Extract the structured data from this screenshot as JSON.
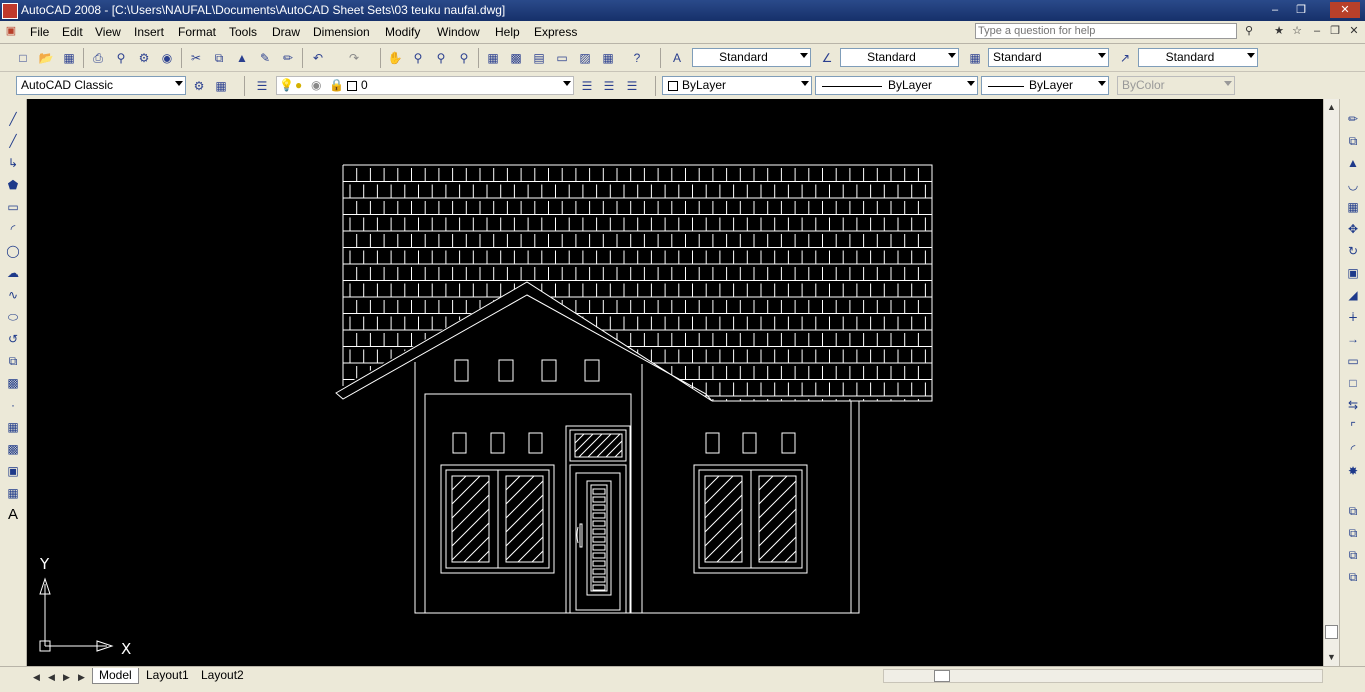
{
  "window": {
    "title": "AutoCAD 2008 - [C:\\Users\\NAUFAL\\Documents\\AutoCAD Sheet Sets\\03 teuku naufal.dwg]",
    "minimize": "–",
    "restore": "❐",
    "close": "✕"
  },
  "menu": {
    "items": [
      "File",
      "Edit",
      "View",
      "Insert",
      "Format",
      "Tools",
      "Draw",
      "Dimension",
      "Modify",
      "Window",
      "Help",
      "Express"
    ],
    "help_placeholder": "Type a question for help"
  },
  "styles_toolbar": {
    "text_style": "Standard",
    "dim_style": "Standard",
    "table_style": "Standard",
    "multileader_style": "Standard"
  },
  "workspace_toolbar": {
    "workspace": "AutoCAD Classic",
    "layer": "0",
    "color": "ByLayer",
    "linetype": "ByLayer",
    "lineweight": "ByLayer",
    "plotstyle": "ByColor"
  },
  "ucs": {
    "x_label": "X",
    "y_label": "Y"
  },
  "layout_tabs": [
    "Model",
    "Layout1",
    "Layout2"
  ],
  "colors": {
    "canvas": "#000000",
    "drawing_lines": "#ffffff",
    "title_bar": "#1c3b7a",
    "chrome": "#ece9d8"
  }
}
